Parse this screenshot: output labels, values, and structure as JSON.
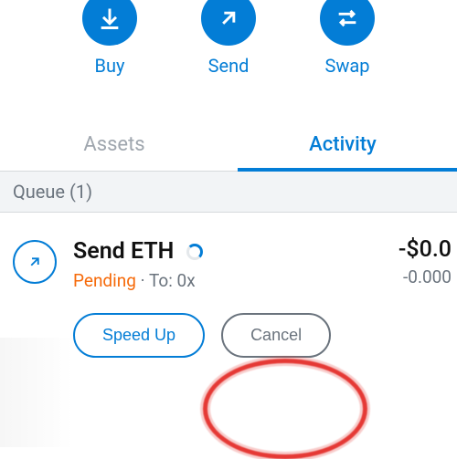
{
  "actions": {
    "buy": "Buy",
    "send": "Send",
    "swap": "Swap"
  },
  "tabs": {
    "assets": "Assets",
    "activity": "Activity"
  },
  "queue": {
    "header": "Queue (1)"
  },
  "tx": {
    "title": "Send ETH",
    "status": "Pending",
    "sep": " · ",
    "to_label": "To: ",
    "to_value": "0x",
    "amount_fiat": "-$0.0",
    "amount_crypto": "-0.000",
    "speed_up": "Speed Up",
    "cancel": "Cancel"
  }
}
